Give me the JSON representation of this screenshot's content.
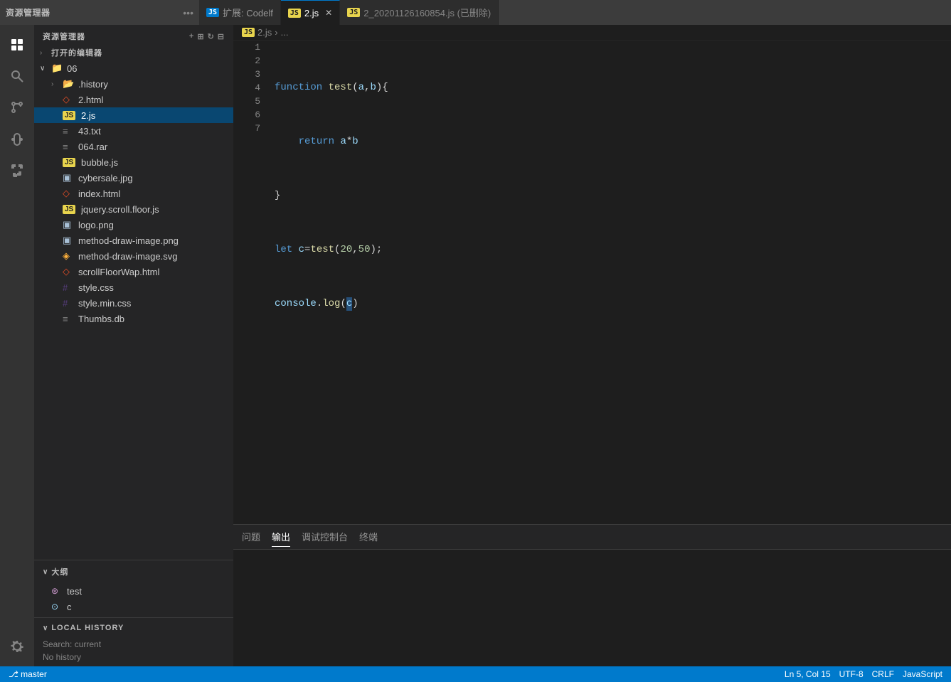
{
  "titleBar": {
    "leftTitle": "资源管理器",
    "moreIcon": "•••",
    "tabs": [
      {
        "id": "ext-codef",
        "icon": "ext",
        "label": "扩展: Codelf",
        "active": false,
        "closeable": false
      },
      {
        "id": "2js",
        "icon": "js",
        "label": "2.js",
        "active": true,
        "closeable": true
      },
      {
        "id": "2js-deleted",
        "icon": "js",
        "label": "2_20201126160854.js (已删除)",
        "active": false,
        "closeable": false
      }
    ]
  },
  "sidebar": {
    "explorerHeader": "资源管理器",
    "openEditors": "打开的编辑器",
    "folder": {
      "name": "06",
      "expanded": true
    },
    "files": [
      {
        "name": ".history",
        "type": "folder",
        "indent": 1,
        "arrow": true
      },
      {
        "name": "2.html",
        "type": "html",
        "indent": 1
      },
      {
        "name": "2.js",
        "type": "js",
        "indent": 1,
        "active": true
      },
      {
        "name": "43.txt",
        "type": "txt",
        "indent": 1
      },
      {
        "name": "064.rar",
        "type": "rar",
        "indent": 1
      },
      {
        "name": "bubble.js",
        "type": "js",
        "indent": 1
      },
      {
        "name": "cybersale.jpg",
        "type": "jpg",
        "indent": 1
      },
      {
        "name": "index.html",
        "type": "html",
        "indent": 1
      },
      {
        "name": "jquery.scroll.floor.js",
        "type": "js",
        "indent": 1
      },
      {
        "name": "logo.png",
        "type": "png",
        "indent": 1
      },
      {
        "name": "method-draw-image.png",
        "type": "png",
        "indent": 1
      },
      {
        "name": "method-draw-image.svg",
        "type": "svg",
        "indent": 1
      },
      {
        "name": "scrollFloorWap.html",
        "type": "html",
        "indent": 1
      },
      {
        "name": "style.css",
        "type": "css",
        "indent": 1
      },
      {
        "name": "style.min.css",
        "type": "css",
        "indent": 1
      },
      {
        "name": "Thumbs.db",
        "type": "db",
        "indent": 1
      }
    ],
    "outline": {
      "header": "大纲",
      "items": [
        {
          "name": "test",
          "type": "function"
        },
        {
          "name": "c",
          "type": "variable"
        }
      ]
    },
    "localHistory": {
      "header": "LOCAL HISTORY",
      "searchLabel": "Search: current",
      "noHistory": "No history"
    }
  },
  "breadcrumb": {
    "parts": [
      "JS 2.js",
      ">",
      "..."
    ]
  },
  "editor": {
    "lines": [
      {
        "num": 1,
        "code": "function test(a,b){"
      },
      {
        "num": 2,
        "code": "    return a*b"
      },
      {
        "num": 3,
        "code": "}"
      },
      {
        "num": 4,
        "code": "let c=test(20,50);"
      },
      {
        "num": 5,
        "code": "console.log(c)"
      },
      {
        "num": 6,
        "code": ""
      },
      {
        "num": 7,
        "code": ""
      }
    ]
  },
  "panel": {
    "tabs": [
      {
        "label": "问题",
        "active": false
      },
      {
        "label": "输出",
        "active": true
      },
      {
        "label": "调试控制台",
        "active": false
      },
      {
        "label": "终端",
        "active": false
      }
    ]
  },
  "icons": {
    "chevron_right": "›",
    "chevron_down": "∨",
    "folder": "📁",
    "file": "📄",
    "close": "✕",
    "ellipsis": "•••"
  }
}
